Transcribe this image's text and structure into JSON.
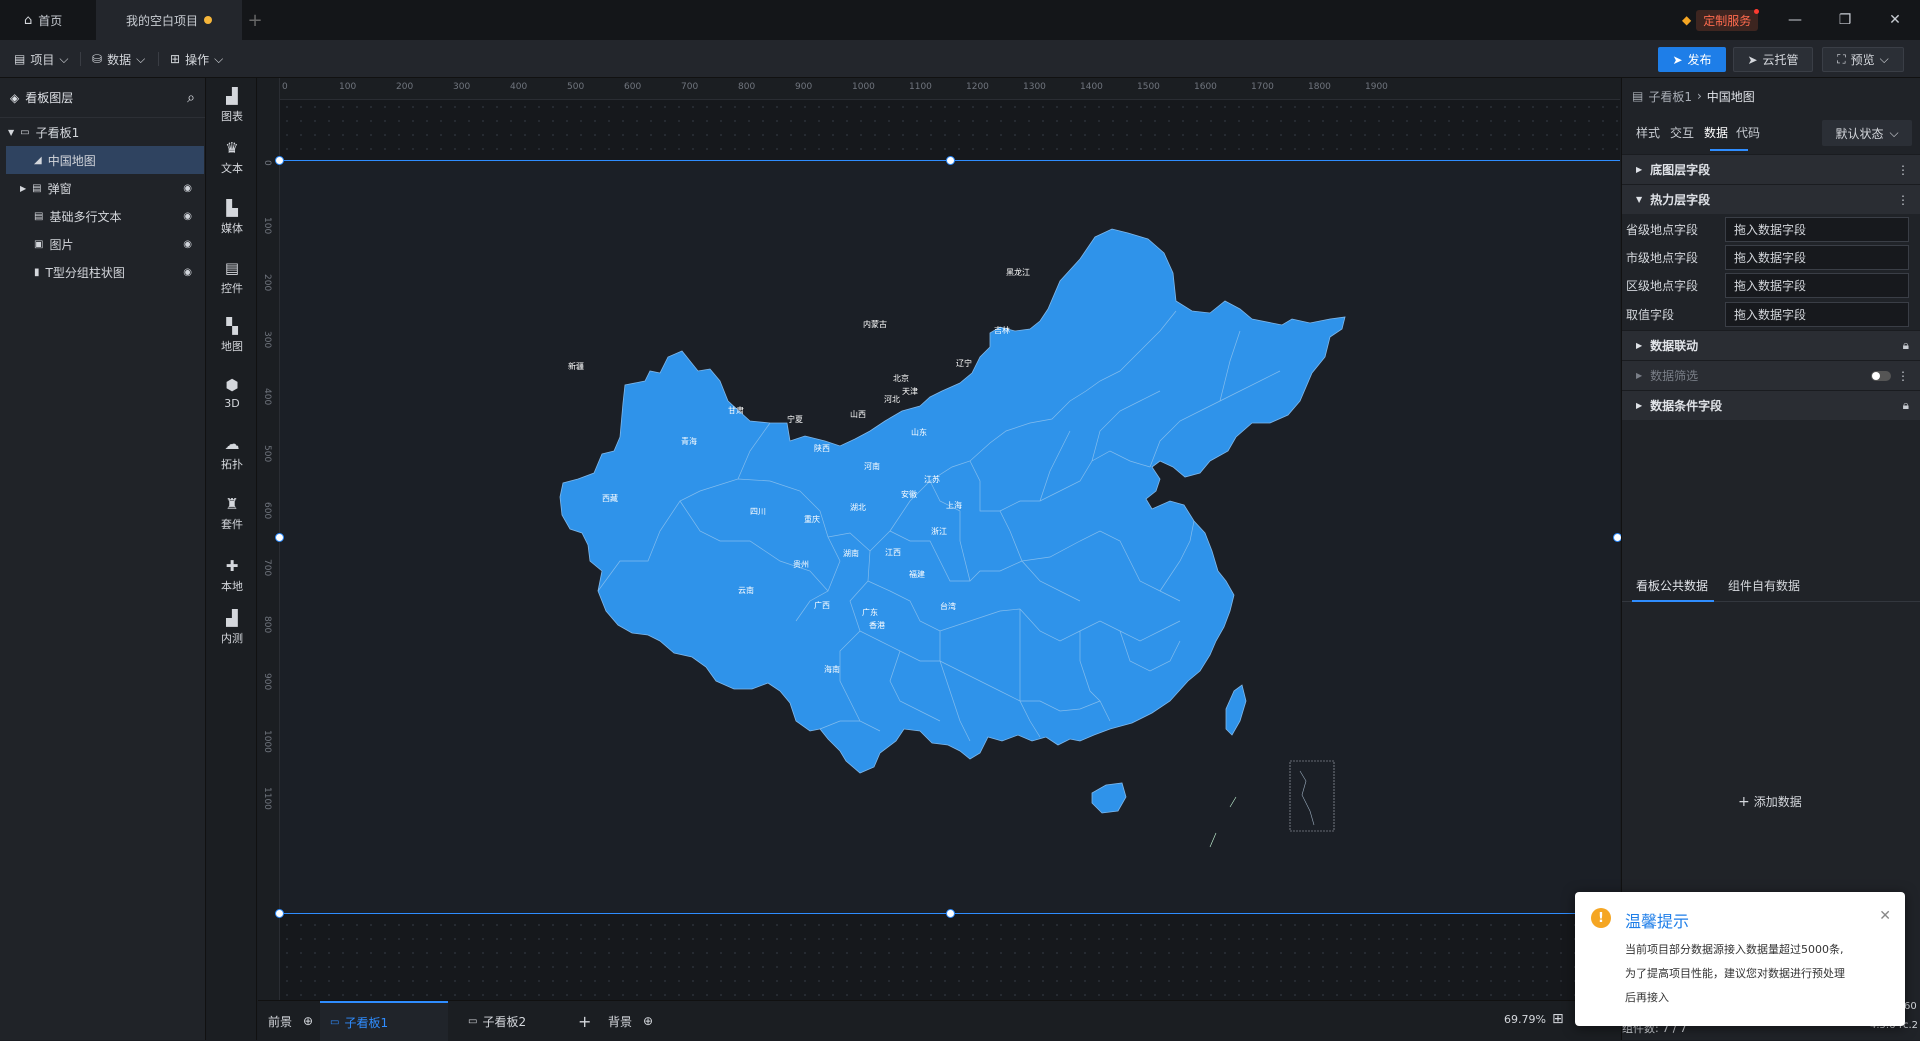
{
  "titlebar": {
    "home_tab": "首页",
    "project_tab": "我的空白项目",
    "custom_service": "定制服务"
  },
  "menubar": {
    "project": "项目",
    "data": "数据",
    "operation": "操作",
    "publish": "发布",
    "cloud": "云托管",
    "preview": "预览"
  },
  "layers": {
    "title": "看板图层",
    "items": [
      {
        "label": "子看板1"
      },
      {
        "label": "中国地图"
      },
      {
        "label": "弹窗"
      },
      {
        "label": "基础多行文本"
      },
      {
        "label": "图片"
      },
      {
        "label": "T型分组柱状图"
      }
    ]
  },
  "toolbox": [
    {
      "label": "图表"
    },
    {
      "label": "文本"
    },
    {
      "label": "媒体"
    },
    {
      "label": "控件"
    },
    {
      "label": "地图"
    },
    {
      "label": "3D"
    },
    {
      "label": "拓扑"
    },
    {
      "label": "套件"
    },
    {
      "label": "本地"
    },
    {
      "label": "内测"
    }
  ],
  "ruler": {
    "top": [
      "0",
      "100",
      "200",
      "300",
      "400",
      "500",
      "600",
      "700",
      "800",
      "900",
      "1000",
      "1100",
      "1200",
      "1300",
      "1400",
      "1500",
      "1600",
      "1700",
      "1800",
      "1900"
    ],
    "left": [
      "0",
      "100",
      "200",
      "300",
      "400",
      "500",
      "600",
      "700",
      "800",
      "900",
      "1000",
      "1100"
    ]
  },
  "map": {
    "provinces": [
      "黑龙江",
      "吉林",
      "辽宁",
      "内蒙古",
      "北京",
      "天津",
      "河北",
      "山西",
      "山东",
      "新疆",
      "甘肃",
      "宁夏",
      "青海",
      "陕西",
      "河南",
      "江苏",
      "上海",
      "安徽",
      "湖北",
      "西藏",
      "四川",
      "重庆",
      "浙江",
      "湖南",
      "江西",
      "贵州",
      "福建",
      "云南",
      "广西",
      "广东",
      "香港",
      "台湾",
      "海南"
    ]
  },
  "pagebar": {
    "front": "前景",
    "board1": "子看板1",
    "board2": "子看板2",
    "add": "+",
    "background": "背景",
    "zoom": "69.79%"
  },
  "right_panel": {
    "breadcrumb_parent": "子看板1",
    "breadcrumb_current": "中国地图",
    "tabs": [
      "样式",
      "交互",
      "数据",
      "代码"
    ],
    "state": "默认状态",
    "sections": {
      "base": "底图层字段",
      "heat": "热力层字段",
      "link": "数据联动",
      "filter": "数据筛选",
      "condition": "数据条件字段"
    },
    "fields": [
      {
        "label": "省级地点字段",
        "value": "拖入数据字段"
      },
      {
        "label": "市级地点字段",
        "value": "拖入数据字段"
      },
      {
        "label": "区级地点字段",
        "value": "拖入数据字段"
      },
      {
        "label": "取值字段",
        "value": "拖入数据字段"
      }
    ],
    "data_tabs": [
      "看板公共数据",
      "组件自有数据"
    ],
    "add_data": "添加数据"
  },
  "notification": {
    "title": "温馨提示",
    "line1": "当前项目部分数据源接入数据量超过5000条,",
    "line2": "为了提高项目性能，建议您对数据进行预处理",
    "line3": "后再接入"
  },
  "status": {
    "component_count": "组件数: 7 / 7",
    "version": "4.5.6-rc.2",
    "num": "60"
  },
  "colors": {
    "accent": "#1e7ee8",
    "map_fill": "#2f93ea",
    "warning": "#f5a623"
  }
}
